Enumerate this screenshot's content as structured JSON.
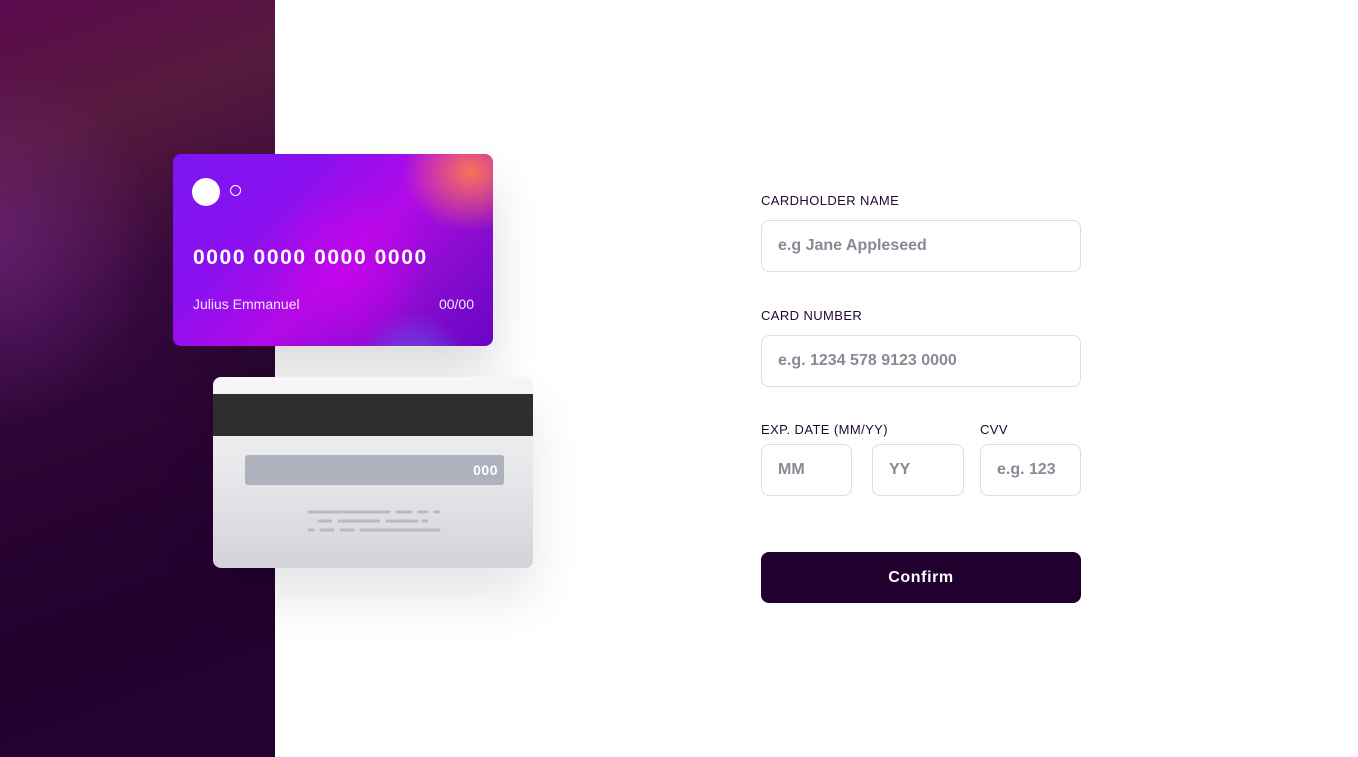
{
  "card_front": {
    "number": "0000 0000 0000 0000",
    "holder": "Julius Emmanuel",
    "expiry": "00/00"
  },
  "card_back": {
    "cvv": "000"
  },
  "form": {
    "name": {
      "label": "CARDHOLDER NAME",
      "placeholder": "e.g Jane Appleseed",
      "value": ""
    },
    "number": {
      "label": "CARD NUMBER",
      "placeholder": "e.g. 1234 578 9123 0000",
      "value": ""
    },
    "expiry": {
      "label": "EXP. DATE (MM/YY)",
      "month_placeholder": "MM",
      "year_placeholder": "YY"
    },
    "cvv": {
      "label": "CVV",
      "placeholder": "e.g. 123"
    },
    "confirm_label": "Confirm"
  },
  "colors": {
    "panel_dark": "#21002f",
    "label_text": "#21092f",
    "placeholder_text": "#8f8694",
    "input_border": "#dedde3",
    "button_bg": "#21002f"
  }
}
